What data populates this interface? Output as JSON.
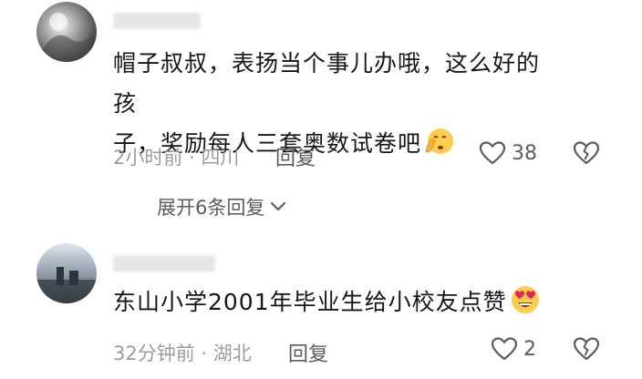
{
  "comments": [
    {
      "text_line1": "帽子叔叔，表扬当个事儿办哦，这么好的孩",
      "text_line2": "子，奖励每人三套奥数试卷吧",
      "emoji": "shushing-face-emoji",
      "time": "2小时前",
      "separator": "·",
      "location": "四川",
      "reply_label": "回复",
      "likes": "38",
      "expand_label": "展开6条回复"
    },
    {
      "text_line1": "东山小学2001年毕业生给小校友点赞",
      "emoji": "heart-eyes-emoji",
      "time": "32分钟前",
      "separator": "·",
      "location": "湖北",
      "reply_label": "回复",
      "likes": "2"
    }
  ],
  "colors": {
    "text": "#161616",
    "meta": "#9c9c9c",
    "action": "#5c5c5c"
  }
}
